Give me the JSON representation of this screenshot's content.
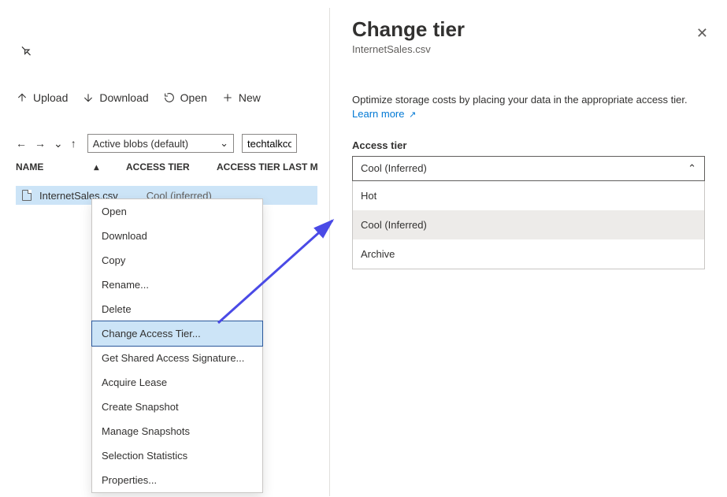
{
  "pin_icon": "📌",
  "toolbar": {
    "upload": "Upload",
    "download": "Download",
    "open": "Open",
    "new": "New"
  },
  "nav": {
    "filter_selected": "Active blobs (default)",
    "path": "techtalkco"
  },
  "table": {
    "col_name": "NAME",
    "col_tier": "ACCESS TIER",
    "col_modified": "ACCESS TIER LAST M"
  },
  "row": {
    "filename": "InternetSales.csv",
    "tier": "Cool (inferred)"
  },
  "context_menu": [
    "Open",
    "Download",
    "Copy",
    "Rename...",
    "Delete",
    "Change Access Tier...",
    "Get Shared Access Signature...",
    "Acquire Lease",
    "Create Snapshot",
    "Manage Snapshots",
    "Selection Statistics",
    "Properties..."
  ],
  "context_highlight_index": 5,
  "panel": {
    "title": "Change tier",
    "subtitle": "InternetSales.csv",
    "description": "Optimize storage costs by placing your data in the appropriate access tier.",
    "learn_more": "Learn more",
    "field_label": "Access tier",
    "selected": "Cool (Inferred)",
    "options": [
      "Hot",
      "Cool (Inferred)",
      "Archive"
    ]
  }
}
